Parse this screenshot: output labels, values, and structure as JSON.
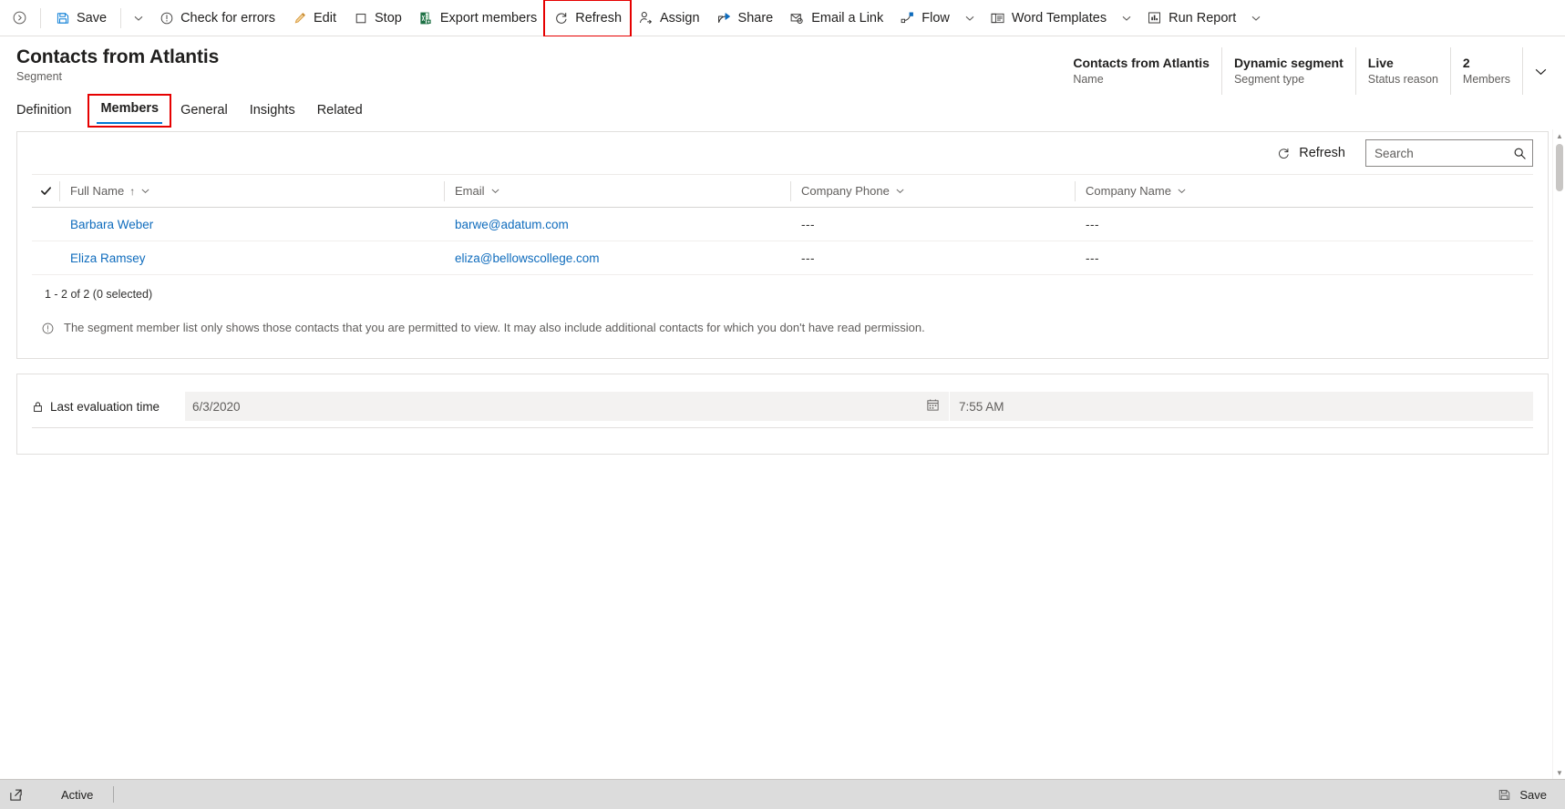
{
  "commandbar": {
    "collapse_icon": "chevron-circle-icon",
    "items": [
      {
        "id": "save",
        "label": "Save",
        "icon": "save-icon",
        "caret": true
      },
      {
        "id": "check-for-errors",
        "label": "Check for errors",
        "icon": "error-circle-icon",
        "caret": false
      },
      {
        "id": "edit",
        "label": "Edit",
        "icon": "pencil-icon",
        "caret": false
      },
      {
        "id": "stop",
        "label": "Stop",
        "icon": "stop-square-icon",
        "caret": false
      },
      {
        "id": "export-members",
        "label": "Export members",
        "icon": "excel-icon",
        "caret": false
      },
      {
        "id": "refresh",
        "label": "Refresh",
        "icon": "refresh-icon",
        "caret": false,
        "highlighted": true
      },
      {
        "id": "assign",
        "label": "Assign",
        "icon": "assign-person-icon",
        "caret": false
      },
      {
        "id": "share",
        "label": "Share",
        "icon": "share-icon",
        "caret": false
      },
      {
        "id": "email-a-link",
        "label": "Email a Link",
        "icon": "email-link-icon",
        "caret": false
      },
      {
        "id": "flow",
        "label": "Flow",
        "icon": "flow-icon",
        "caret": true
      },
      {
        "id": "word-templates",
        "label": "Word Templates",
        "icon": "word-template-icon",
        "caret": true
      },
      {
        "id": "run-report",
        "label": "Run Report",
        "icon": "report-icon",
        "caret": true
      }
    ]
  },
  "header": {
    "title": "Contacts from Atlantis",
    "subtitle": "Segment",
    "expand_icon": "chevron-down-icon",
    "info": [
      {
        "value": "Contacts from Atlantis",
        "label": "Name"
      },
      {
        "value": "Dynamic segment",
        "label": "Segment type"
      },
      {
        "value": "Live",
        "label": "Status reason"
      },
      {
        "value": "2",
        "label": "Members"
      }
    ]
  },
  "tabs": [
    {
      "id": "definition",
      "label": "Definition",
      "active": false,
      "highlighted": false
    },
    {
      "id": "members",
      "label": "Members",
      "active": true,
      "highlighted": true
    },
    {
      "id": "general",
      "label": "General",
      "active": false,
      "highlighted": false
    },
    {
      "id": "insights",
      "label": "Insights",
      "active": false,
      "highlighted": false
    },
    {
      "id": "related",
      "label": "Related",
      "active": false,
      "highlighted": false
    }
  ],
  "grid": {
    "refresh_label": "Refresh",
    "refresh_icon": "refresh-icon",
    "search": {
      "value": "",
      "placeholder": "Search",
      "icon": "search-icon"
    },
    "select_all_icon": "checkmark-icon",
    "columns": [
      {
        "label": "Full Name",
        "sorted": true,
        "sort_arrow": "↑"
      },
      {
        "label": "Email",
        "sorted": false,
        "sort_arrow": ""
      },
      {
        "label": "Company Phone",
        "sorted": false,
        "sort_arrow": ""
      },
      {
        "label": "Company Name",
        "sorted": false,
        "sort_arrow": ""
      }
    ],
    "rows": [
      {
        "full_name": "Barbara Weber",
        "email": "barwe@adatum.com",
        "company_phone": "---",
        "company_name": "---"
      },
      {
        "full_name": "Eliza Ramsey",
        "email": "eliza@bellowscollege.com",
        "company_phone": "---",
        "company_name": "---"
      }
    ],
    "footer": "1 - 2 of 2 (0 selected)",
    "notice": "The segment member list only shows those contacts that you are permitted to view. It may also include additional contacts for which you don't have read permission.",
    "notice_icon": "info-circle-icon"
  },
  "evaluation": {
    "label": "Last evaluation time",
    "lock_icon": "lock-icon",
    "date_value": "6/3/2020",
    "time_value": "7:55 AM",
    "calendar_icon": "calendar-icon"
  },
  "statusbar": {
    "left_icon": "popout-icon",
    "state": "Active",
    "save_label": "Save",
    "save_icon": "save-icon"
  },
  "colors": {
    "accent": "#0078d4",
    "link": "#0f6cbd",
    "highlight": "#e60000",
    "excel_green": "#1d7044",
    "status_bar": "#dcdcdc"
  }
}
